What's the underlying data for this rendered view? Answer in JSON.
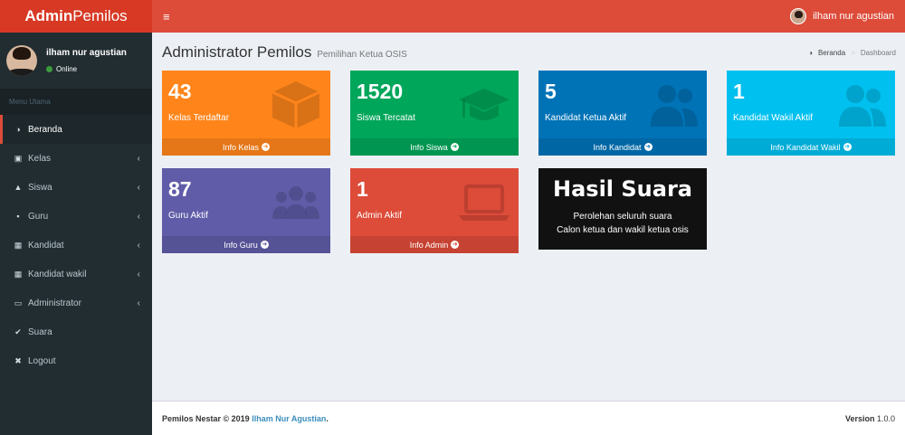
{
  "header": {
    "logo_bold": "Admin",
    "logo_rest": "Pemilos",
    "toggle": "≡",
    "user": "ilham nur agustian"
  },
  "sidebar": {
    "user_name": "ilham nur agustian",
    "status": "Online",
    "menu_header": "Menu Utama",
    "items": [
      {
        "label": "Beranda",
        "icon": "dashboard-icon",
        "glyph": "◑"
      },
      {
        "label": "Kelas",
        "icon": "cube-icon",
        "glyph": "▣"
      },
      {
        "label": "Siswa",
        "icon": "graduation-cap-icon",
        "glyph": "▲"
      },
      {
        "label": "Guru",
        "icon": "id-badge-icon",
        "glyph": "▪"
      },
      {
        "label": "Kandidat",
        "icon": "calendar-icon",
        "glyph": "▦"
      },
      {
        "label": "Kandidat wakil",
        "icon": "calendar-icon",
        "glyph": "▦"
      },
      {
        "label": "Administrator",
        "icon": "laptop-icon",
        "glyph": "▭"
      },
      {
        "label": "Suara",
        "icon": "check-icon",
        "glyph": "✔"
      },
      {
        "label": "Logout",
        "icon": "times-icon",
        "glyph": "✖"
      }
    ]
  },
  "content": {
    "title": "Administrator Pemilos",
    "subtitle": "Pemilihan Ketua OSIS",
    "breadcrumb_home": "Beranda",
    "breadcrumb_current": "Dashboard"
  },
  "boxes": [
    {
      "num": "43",
      "label": "Kelas Terdaftar",
      "link": "Info Kelas",
      "color": "#ff851b"
    },
    {
      "num": "1520",
      "label": "Siswa Tercatat",
      "link": "Info Siswa",
      "color": "#00a65a"
    },
    {
      "num": "5",
      "label": "Kandidat Ketua Aktif",
      "link": "Info Kandidat",
      "color": "#0073b7"
    },
    {
      "num": "1",
      "label": "Kandidat Wakil Aktif",
      "link": "Info Kandidat Wakil",
      "color": "#00c0ef"
    },
    {
      "num": "87",
      "label": "Guru Aktif",
      "link": "Info Guru",
      "color": "#605ca8"
    },
    {
      "num": "1",
      "label": "Admin Aktif",
      "link": "Info Admin",
      "color": "#dd4b39"
    }
  ],
  "hasil": {
    "title": "Hasil Suara",
    "line1": "Perolehan seluruh suara",
    "line2": "Calon ketua dan wakil ketua osis"
  },
  "footer": {
    "left_prefix": "Pemilos Nestar © 2019",
    "author": "Ilham Nur Agustian",
    "left_suffix": ".",
    "version_label": "Version",
    "version": "1.0.0"
  }
}
